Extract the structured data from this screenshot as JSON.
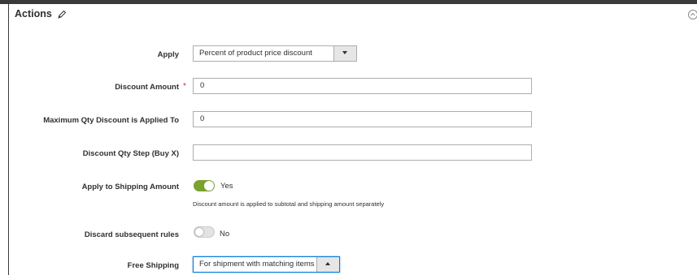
{
  "section": {
    "title": "Actions"
  },
  "fields": {
    "apply": {
      "label": "Apply",
      "value": "Percent of product price discount"
    },
    "discount_amount": {
      "label": "Discount Amount",
      "required_mark": "*",
      "value": "0"
    },
    "max_qty": {
      "label": "Maximum Qty Discount is Applied To",
      "value": "0"
    },
    "discount_step": {
      "label": "Discount Qty Step (Buy X)",
      "value": ""
    },
    "apply_shipping": {
      "label": "Apply to Shipping Amount",
      "state": "Yes",
      "on": true,
      "note": "Discount amount is applied to subtotal and shipping amount separately"
    },
    "discard_rules": {
      "label": "Discard subsequent rules",
      "state": "No",
      "on": false
    },
    "free_shipping": {
      "label": "Free Shipping",
      "value": "For shipment with matching items"
    }
  },
  "icons": {
    "edit": "pencil-icon",
    "collapse": "collapse-circle-icon",
    "dropdown": "triangle-down-icon",
    "dropdown_open": "triangle-up-icon"
  },
  "colors": {
    "toggle_on": "#79a22e",
    "required": "#e22626",
    "focus": "#007bdb"
  }
}
